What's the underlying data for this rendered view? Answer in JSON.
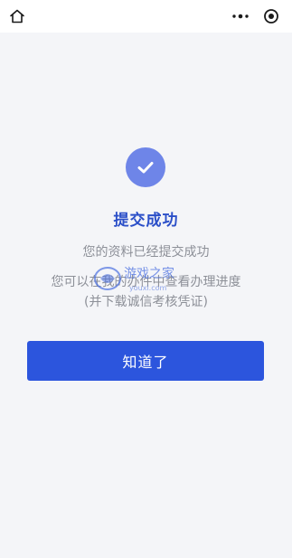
{
  "topbar": {
    "icons": [
      "home-icon",
      "more-dots-icon",
      "target-icon"
    ]
  },
  "result": {
    "icon": "check-icon",
    "accent_color": "#2b4fc8",
    "title": "提交成功",
    "message_1": "您的资料已经提交成功",
    "message_2": "您可以在我的办件中查看办理进度",
    "message_3": "(并下载诚信考核凭证)"
  },
  "watermark": {
    "text": "游戏之家"
  },
  "actions": {
    "confirm_label": "知道了",
    "button_color": "#2c55dd"
  }
}
